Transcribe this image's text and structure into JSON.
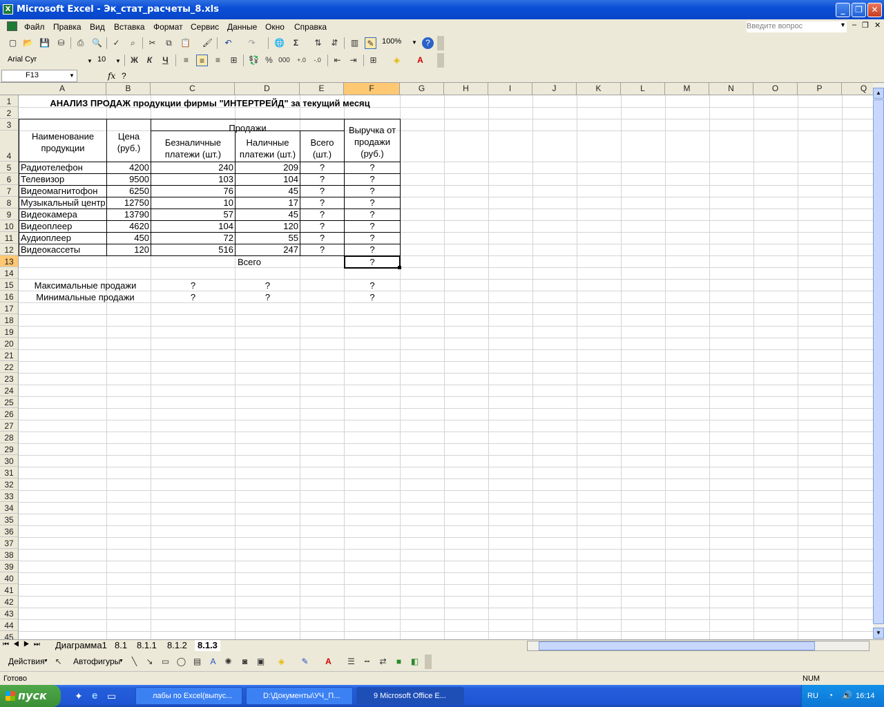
{
  "window": {
    "title": "Microsoft Excel - Эк_стат_расчеты_8.xls",
    "buttons": {
      "minimize": "_",
      "restore": "❐",
      "close": "✕"
    }
  },
  "menu": {
    "items": [
      "Файл",
      "Правка",
      "Вид",
      "Вставка",
      "Формат",
      "Сервис",
      "Данные",
      "Окно",
      "Справка"
    ],
    "help_placeholder": "Введите вопрос"
  },
  "toolbar": {
    "zoom": "100%",
    "font": "Arial Cyr",
    "size": "10",
    "bold": "Ж",
    "italic": "К",
    "underline": "Ч",
    "percent": "%",
    "thousands": "000",
    "sum": "Σ"
  },
  "formula_bar": {
    "name_box": "F13",
    "fx": "fx",
    "content": "?"
  },
  "columns": [
    "A",
    "B",
    "C",
    "D",
    "E",
    "F",
    "G",
    "H",
    "I",
    "J",
    "K",
    "L",
    "M",
    "N",
    "O",
    "P",
    "Q"
  ],
  "rows": [
    "1",
    "2",
    "3",
    "4",
    "5",
    "6",
    "7",
    "8",
    "9",
    "10",
    "11",
    "12",
    "13",
    "14",
    "15",
    "16",
    "17",
    "18",
    "19",
    "20",
    "21",
    "22",
    "23",
    "24",
    "25",
    "26",
    "27",
    "28",
    "29",
    "30",
    "31",
    "32",
    "33",
    "34",
    "35",
    "36",
    "37",
    "38",
    "39",
    "40",
    "41",
    "42",
    "43",
    "44",
    "45"
  ],
  "sheet": {
    "title": "АНАЛИЗ ПРОДАЖ продукции фирмы \"ИНТЕРТРЕЙД\" за текущий месяц",
    "headers": {
      "name": "Наименование продукции",
      "price": "Цена (руб.)",
      "sales": "Продажи",
      "cashless": "Безналичные платежи (шт.)",
      "cash": "Наличные платежи (шт.)",
      "total": "Всего (шт.)",
      "revenue": "Выручка от продажи (руб.)"
    },
    "products": [
      {
        "name": "Радиотелефон",
        "price": "4200",
        "cashless": "240",
        "cash": "209",
        "total": "?",
        "revenue": "?"
      },
      {
        "name": "Телевизор",
        "price": "9500",
        "cashless": "103",
        "cash": "104",
        "total": "?",
        "revenue": "?"
      },
      {
        "name": "Видеомагнитофон",
        "price": "6250",
        "cashless": "76",
        "cash": "45",
        "total": "?",
        "revenue": "?"
      },
      {
        "name": "Музыкальный центр",
        "price": "12750",
        "cashless": "10",
        "cash": "17",
        "total": "?",
        "revenue": "?"
      },
      {
        "name": "Видеокамера",
        "price": "13790",
        "cashless": "57",
        "cash": "45",
        "total": "?",
        "revenue": "?"
      },
      {
        "name": "Видеоплеер",
        "price": "4620",
        "cashless": "104",
        "cash": "120",
        "total": "?",
        "revenue": "?"
      },
      {
        "name": "Аудиоплеер",
        "price": "450",
        "cashless": "72",
        "cash": "55",
        "total": "?",
        "revenue": "?"
      },
      {
        "name": "Видеокассеты",
        "price": "120",
        "cashless": "516",
        "cash": "247",
        "total": "?",
        "revenue": "?"
      }
    ],
    "total_label": "Всего",
    "total_value": "?",
    "max_label": "Максимальные продажи",
    "min_label": "Минимальные продажи",
    "max_values": {
      "c": "?",
      "d": "?",
      "f": "?"
    },
    "min_values": {
      "c": "?",
      "d": "?",
      "f": "?"
    }
  },
  "tabs": [
    "Диаграмма1",
    "8.1",
    "8.1.1",
    "8.1.2",
    "8.1.3"
  ],
  "active_tab": "8.1.3",
  "drawing": {
    "actions": "Действия",
    "autoshapes": "Автофигуры"
  },
  "status": {
    "left": "Готово",
    "num": "NUM"
  },
  "taskbar": {
    "start": "пуск",
    "tasks": [
      "лабы по Excel(выпус...",
      "D:\\Документы\\УЧ_П...",
      "9 Microsoft Office E..."
    ],
    "lang": "RU",
    "time": "16:14"
  }
}
